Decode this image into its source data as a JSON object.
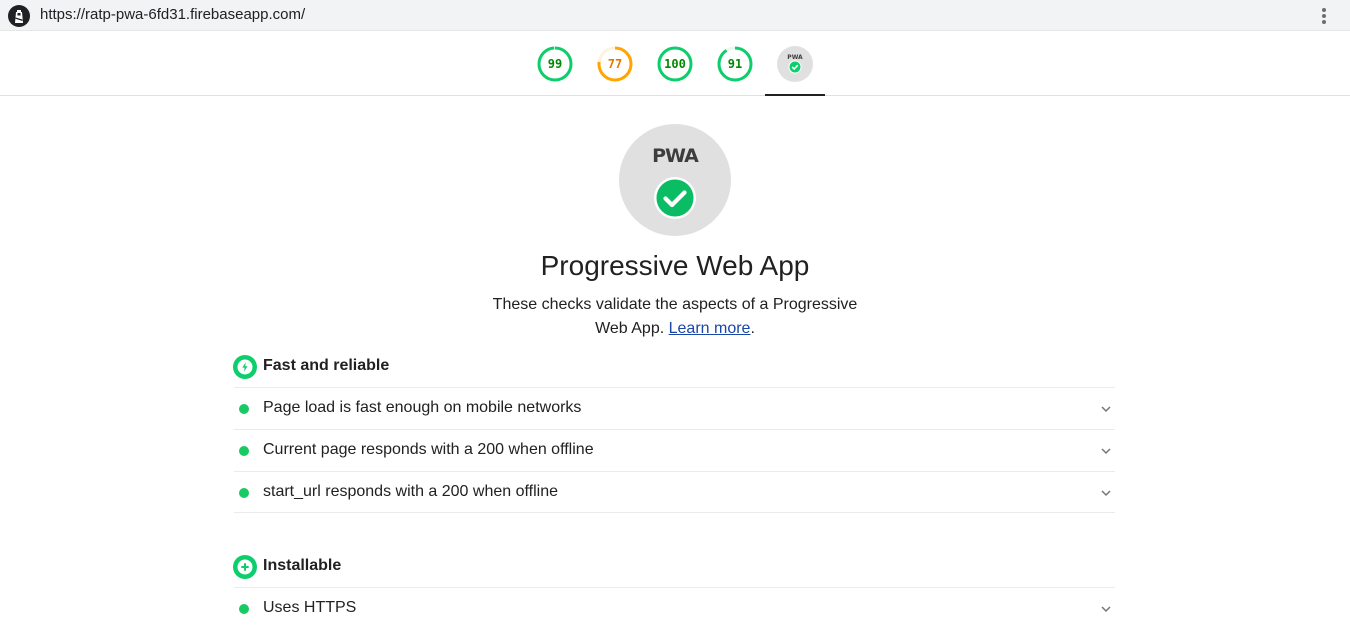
{
  "browser": {
    "url": "https://ratp-pwa-6fd31.firebaseapp.com/"
  },
  "gauges": [
    {
      "name": "gauge-performance",
      "score": "99",
      "value": 0.99,
      "color": "#0cce6b"
    },
    {
      "name": "gauge-accessibility",
      "score": "77",
      "value": 0.77,
      "color": "#ffa400"
    },
    {
      "name": "gauge-best-practices",
      "score": "100",
      "value": 1.0,
      "color": "#0cce6b"
    },
    {
      "name": "gauge-seo",
      "score": "91",
      "value": 0.91,
      "color": "#0cce6b"
    }
  ],
  "pwa": {
    "badge_text": "PWA",
    "title": "Progressive Web App",
    "description": "These checks validate the aspects of a Progressive Web App.",
    "learn_more": "Learn more",
    "trailing_period": "."
  },
  "groups": {
    "fast": {
      "title": "Fast and reliable",
      "audits": [
        "Page load is fast enough on mobile networks",
        "Current page responds with a 200 when offline",
        "start_url responds with a 200 when offline"
      ]
    },
    "installable": {
      "title": "Installable",
      "audits": [
        "Uses HTTPS"
      ]
    }
  },
  "colors": {
    "pass": "#0cce6b",
    "average": "#ffa400",
    "link": "#1a47a6"
  }
}
